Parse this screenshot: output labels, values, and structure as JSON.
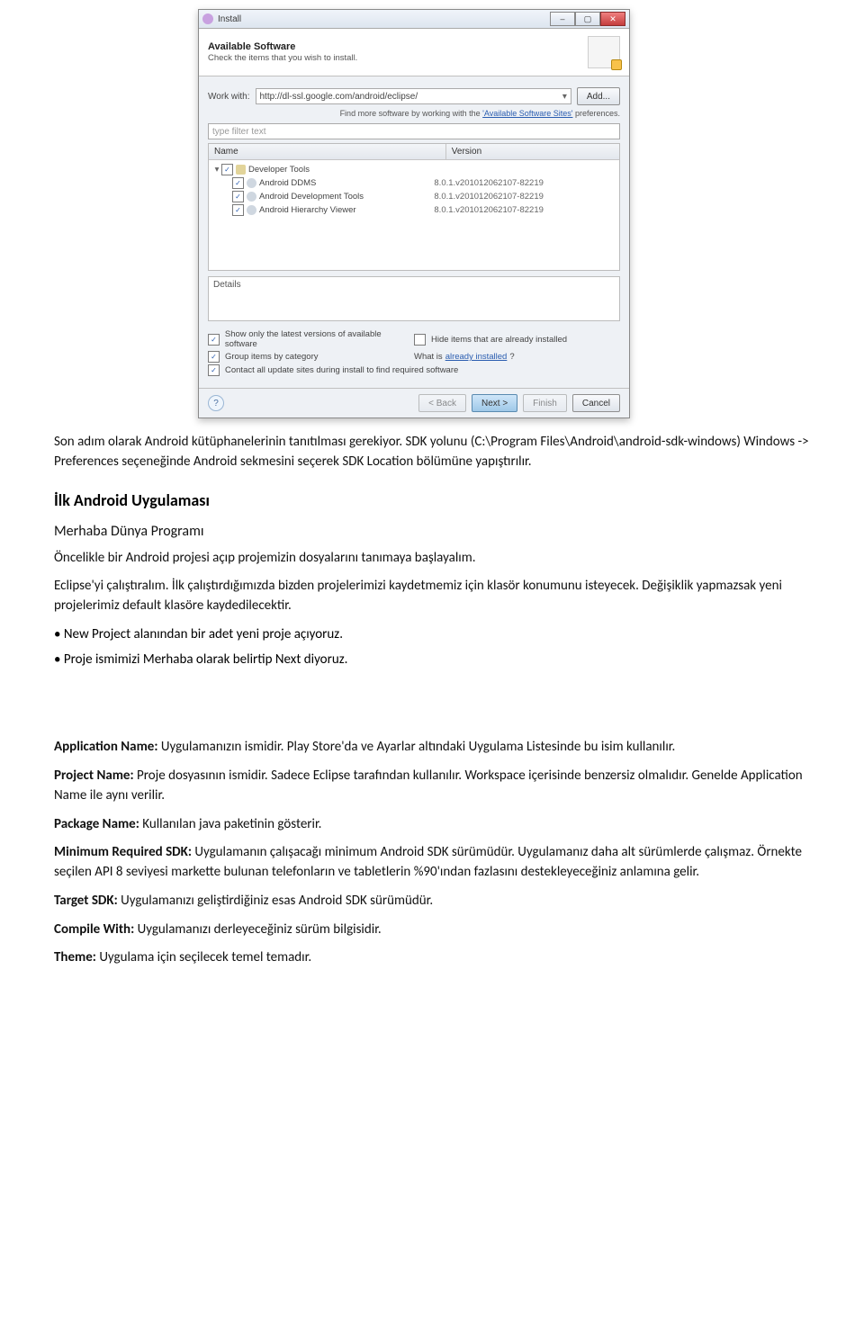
{
  "installer": {
    "title": "Install",
    "banner_title": "Available Software",
    "banner_sub": "Check the items that you wish to install.",
    "work_with_label": "Work with:",
    "work_with_value": "http://dl-ssl.google.com/android/eclipse/",
    "add_btn": "Add...",
    "hint_prefix": "Find more software by working with the ",
    "hint_link": "'Available Software Sites'",
    "hint_suffix": " preferences.",
    "filter_placeholder": "type filter text",
    "col_name": "Name",
    "col_version": "Version",
    "tree": {
      "group": "Developer Tools",
      "items": [
        {
          "name": "Android DDMS",
          "version": "8.0.1.v201012062107-82219"
        },
        {
          "name": "Android Development Tools",
          "version": "8.0.1.v201012062107-82219"
        },
        {
          "name": "Android Hierarchy Viewer",
          "version": "8.0.1.v201012062107-82219"
        }
      ]
    },
    "details_label": "Details",
    "opt_show_latest": "Show only the latest versions of available software",
    "opt_hide_installed": "Hide items that are already installed",
    "opt_group": "Group items by category",
    "opt_whatis": "What is ",
    "opt_whatis_link": "already installed",
    "opt_whatis_suffix": "?",
    "opt_contact": "Contact all update sites during install to find required software",
    "btn_back": "< Back",
    "btn_next": "Next >",
    "btn_finish": "Finish",
    "btn_cancel": "Cancel"
  },
  "doc": {
    "p1": "Son adım olarak Android kütüphanelerinin tanıtılması gerekiyor. SDK yolunu (C:\\Program Files\\Android\\android-sdk-windows) Windows -> Preferences seçeneğinde Android sekmesini seçerek SDK Location bölümüne yapıştırılır.",
    "h_first_app": "İlk Android Uygulaması",
    "h_hello": "Merhaba Dünya Programı",
    "p2": "Öncelikle bir Android projesi açıp projemizin dosyalarını tanımaya başlayalım.",
    "p3": "Eclipse'yi çalıştıralım. İlk çalıştırdığımızda bizden projelerimizi kaydetmemiz için klasör konumunu isteyecek. Değişiklik yapmazsak yeni projelerimiz default klasöre kaydedilecektir.",
    "b1": "New Project alanından bir adet yeni proje açıyoruz.",
    "b2": "Proje ismimizi Merhaba olarak belirtip Next diyoruz.",
    "app_name_lbl": "Application Name:",
    "app_name_txt": " Uygulamanızın ismidir. Play Store'da ve Ayarlar altındaki Uygulama Listesinde bu isim kullanılır.",
    "proj_name_lbl": "Project Name:",
    "proj_name_txt": " Proje dosyasının ismidir. Sadece Eclipse tarafından kullanılır. Workspace içerisinde benzersiz olmalıdır. Genelde Application Name ile aynı verilir.",
    "pkg_name_lbl": "Package Name:",
    "pkg_name_txt": " Kullanılan java paketinin gösterir.",
    "min_sdk_lbl": "Minimum Required SDK:",
    "min_sdk_txt": " Uygulamanın çalışacağı minimum Android SDK sürümüdür. Uygulamanız daha alt sürümlerde çalışmaz. Örnekte seçilen API 8 seviyesi markette bulunan telefonların ve tabletlerin %90'ından fazlasını destekleyeceğiniz anlamına gelir.",
    "tgt_sdk_lbl": "Target SDK:",
    "tgt_sdk_txt": " Uygulamanızı geliştirdiğiniz esas Android SDK sürümüdür.",
    "compile_lbl": "Compile With:",
    "compile_txt": "  Uygulamanızı derleyeceğiniz sürüm bilgisidir.",
    "theme_lbl": "Theme:",
    "theme_txt": " Uygulama için seçilecek temel temadır."
  }
}
